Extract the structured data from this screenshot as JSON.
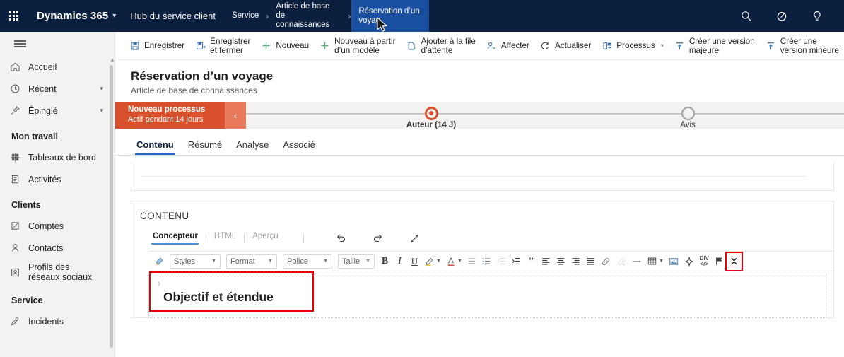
{
  "topbar": {
    "waffle_name": "app-launcher",
    "brand": "Dynamics 365",
    "app_name": "Hub du service client",
    "breadcrumbs": [
      {
        "label": "Service",
        "active": false
      },
      {
        "label": "Article de base de connaissances",
        "active": false
      },
      {
        "label": "Réservation d’un voyag",
        "active": true
      }
    ],
    "icons": [
      {
        "name": "search-icon",
        "label": "Recherche"
      },
      {
        "name": "filter-icon",
        "label": "Filtre"
      },
      {
        "name": "lightbulb-icon",
        "label": "Assistant"
      }
    ]
  },
  "sidebar": {
    "hamburger_label": "Développer le volet de navigation",
    "items": [
      {
        "label": "Accueil",
        "icon": "home-icon",
        "chevron": false
      },
      {
        "label": "Récent",
        "icon": "clock-icon",
        "chevron": true
      },
      {
        "label": "Épinglé",
        "icon": "pin-icon",
        "chevron": true
      }
    ],
    "groups": [
      {
        "title": "Mon travail",
        "items": [
          {
            "label": "Tableaux de bord",
            "icon": "dashboard-icon"
          },
          {
            "label": "Activités",
            "icon": "activities-icon"
          }
        ]
      },
      {
        "title": "Clients",
        "items": [
          {
            "label": "Comptes",
            "icon": "accounts-icon"
          },
          {
            "label": "Contacts",
            "icon": "contact-icon"
          },
          {
            "label": "Profils des\nréseaux sociaux",
            "icon": "social-profile-icon"
          }
        ]
      },
      {
        "title": "Service",
        "items": [
          {
            "label": "Incidents",
            "icon": "case-icon"
          }
        ]
      }
    ]
  },
  "commandbar": [
    {
      "label": "Enregistrer",
      "icon": "save-icon",
      "dropdown": false
    },
    {
      "label": "Enregistrer\net fermer",
      "icon": "save-close-icon",
      "dropdown": false
    },
    {
      "label": "Nouveau",
      "icon": "plus-icon",
      "dropdown": false
    },
    {
      "label": "Nouveau à partir\nd’un modèle",
      "icon": "plus-icon",
      "dropdown": false
    },
    {
      "label": "Ajouter à la file\nd’attente",
      "icon": "queue-icon",
      "dropdown": false
    },
    {
      "label": "Affecter",
      "icon": "assign-user-icon",
      "dropdown": false
    },
    {
      "label": "Actualiser",
      "icon": "refresh-icon",
      "dropdown": false
    },
    {
      "label": "Processus",
      "icon": "process-icon",
      "dropdown": true
    },
    {
      "label": "Créer une version\nmajeure",
      "icon": "major-version-icon",
      "dropdown": false
    },
    {
      "label": "Créer une\nversion mineure",
      "icon": "minor-version-icon",
      "dropdown": false
    }
  ],
  "record": {
    "title": "Réservation d’un voyage",
    "subtitle": "Article de base de connaissances"
  },
  "process_flow": {
    "name": "Nouveau processus",
    "status": "Actif pendant 14 jours",
    "back_label": "Étape précédente",
    "stages": [
      {
        "label": "Auteur (14 J)",
        "state": "active"
      },
      {
        "label": "Avis",
        "state": "idle"
      }
    ]
  },
  "tabs": [
    {
      "label": "Contenu",
      "active": true
    },
    {
      "label": "Résumé",
      "active": false
    },
    {
      "label": "Analyse",
      "active": false
    },
    {
      "label": "Associé",
      "active": false
    }
  ],
  "content_section": {
    "header": "CONTENU",
    "editor_tabs": [
      {
        "label": "Concepteur",
        "active": true
      },
      {
        "label": "HTML",
        "active": false
      },
      {
        "label": "Aperçu",
        "active": false
      }
    ],
    "editor_actions": [
      {
        "name": "undo-icon",
        "label": "Annuler"
      },
      {
        "name": "redo-icon",
        "label": "Rétablir"
      },
      {
        "name": "expand-icon",
        "label": "Agrandir"
      }
    ],
    "toolbar": {
      "brush": {
        "name": "format-painter-icon",
        "label": "Reproduire la mise en forme"
      },
      "selects": [
        {
          "name": "styles-select",
          "value": "Styles"
        },
        {
          "name": "format-select",
          "value": "Format"
        },
        {
          "name": "font-select",
          "value": "Police"
        },
        {
          "name": "size-select",
          "value": "Taille"
        }
      ],
      "buttons": [
        {
          "name": "bold-button",
          "glyph": "B",
          "label": "Gras"
        },
        {
          "name": "italic-button",
          "glyph": "I",
          "label": "Italique"
        },
        {
          "name": "underline-button",
          "glyph": "U",
          "label": "Souligné"
        },
        {
          "name": "highlight-color-button",
          "glyph": "highlighter",
          "label": "Couleur de surbrillance"
        },
        {
          "name": "font-color-button",
          "glyph": "fontcolor",
          "label": "Couleur de police"
        },
        {
          "name": "bulleted-list-button",
          "glyph": "bullets",
          "label": "Liste à puces"
        },
        {
          "name": "numbered-list-button",
          "glyph": "numbers",
          "label": "Liste numérotée"
        },
        {
          "name": "decrease-indent-button",
          "glyph": "outdent",
          "label": "Diminuer le retrait"
        },
        {
          "name": "increase-indent-button",
          "glyph": "indent",
          "label": "Augmenter le retrait"
        },
        {
          "name": "blockquote-button",
          "glyph": "”",
          "label": "Citation"
        },
        {
          "name": "align-left-button",
          "glyph": "alignleft",
          "label": "Aligner à gauche"
        },
        {
          "name": "align-center-button",
          "glyph": "aligncenter",
          "label": "Centrer"
        },
        {
          "name": "align-right-button",
          "glyph": "alignright",
          "label": "Aligner à droite"
        },
        {
          "name": "align-justify-button",
          "glyph": "alignjustify",
          "label": "Justifier"
        },
        {
          "name": "insert-link-button",
          "glyph": "link",
          "label": "Insérer un lien"
        },
        {
          "name": "remove-link-button",
          "glyph": "unlink",
          "label": "Supprimer le lien"
        },
        {
          "name": "horizontal-rule-button",
          "glyph": "hrule",
          "label": "Ligne horizontale"
        },
        {
          "name": "insert-table-button",
          "glyph": "table",
          "label": "Tableau"
        },
        {
          "name": "insert-image-button",
          "glyph": "image",
          "label": "Image"
        },
        {
          "name": "special-character-button",
          "glyph": "sparkle",
          "label": "Caractère spécial"
        },
        {
          "name": "source-code-button",
          "glyph": "div",
          "label": "Code source"
        },
        {
          "name": "anchor-button",
          "glyph": "flag",
          "label": "Ancre"
        },
        {
          "name": "collapse-toolbar-button",
          "glyph": "collapse",
          "label": "Réduire la barre d’outils",
          "highlighted": true
        }
      ]
    },
    "document": {
      "chevron": "›",
      "heading": "Objectif et étendue",
      "highlighted": true
    }
  },
  "colors": {
    "nav_background": "#0b1f3f",
    "breadcrumb_active": "#1b4fa0",
    "process_accent": "#d9512c",
    "tab_underline": "#2266cc",
    "highlight_box": "#e60000",
    "sidebar_background": "#f3f2f1"
  }
}
